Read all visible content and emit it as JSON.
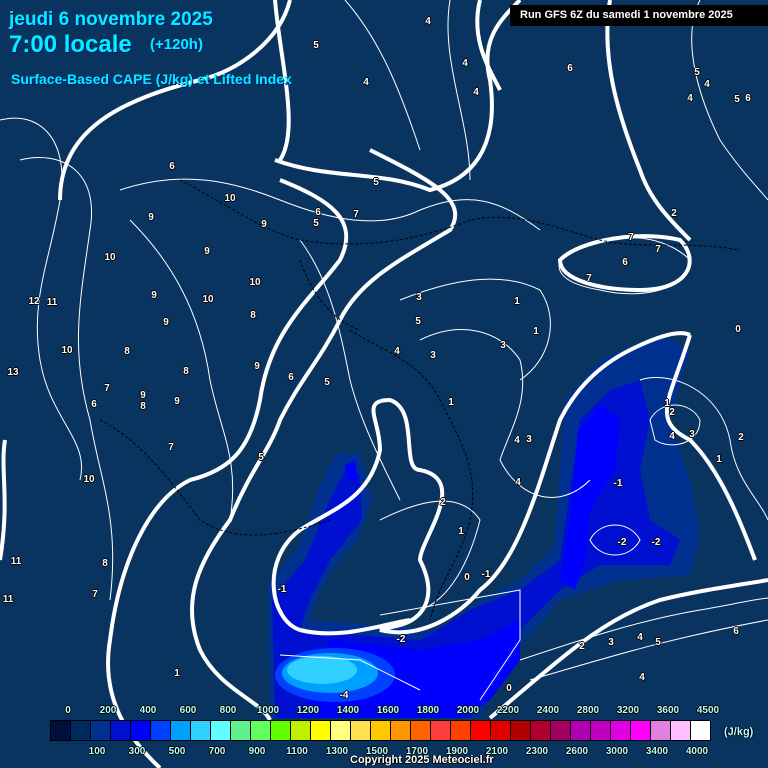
{
  "header": {
    "date": "jeudi 6 novembre 2025",
    "time": "7:00 locale",
    "lead": "(+120h)",
    "parameter": "Surface-Based CAPE (J/kg) et Lifted Index",
    "run": "Run GFS 6Z du samedi 1 novembre 2025"
  },
  "colors": {
    "background": "#0a3460",
    "contour": "#ffffff",
    "title": "#00f0ff"
  },
  "legend": {
    "unit": "(J/kg)",
    "colors": [
      "#00103c",
      "#002a5e",
      "#003090",
      "#0010d0",
      "#0000ff",
      "#0040ff",
      "#00a0ff",
      "#30d0ff",
      "#60ffff",
      "#60f090",
      "#60ff60",
      "#60ff00",
      "#c0f000",
      "#ffff00",
      "#ffff80",
      "#ffe050",
      "#ffc800",
      "#ff9600",
      "#ff6400",
      "#ff3c3c",
      "#ff4000",
      "#ff0000",
      "#e00000",
      "#b00000",
      "#b00030",
      "#a00060",
      "#b000b0",
      "#c000c0",
      "#e000e0",
      "#ff00ff",
      "#e080e0",
      "#ffc0ff",
      "#ffffff"
    ],
    "top_labels": [
      "0",
      "200",
      "400",
      "600",
      "800",
      "1000",
      "1200",
      "1400",
      "1600",
      "1800",
      "2000",
      "2200",
      "2400",
      "2800",
      "3200",
      "3600",
      "4500"
    ],
    "bottom_labels": [
      "100",
      "300",
      "500",
      "700",
      "900",
      "1100",
      "1300",
      "1500",
      "1700",
      "1900",
      "2100",
      "2300",
      "2600",
      "3000",
      "3400",
      "4000"
    ]
  },
  "lifted_index_labels": [
    "4",
    "5",
    "4",
    "4",
    "4",
    "6",
    "5",
    "4",
    "4",
    "5",
    "6",
    "6",
    "5",
    "10",
    "9",
    "9",
    "6",
    "5",
    "7",
    "2",
    "7",
    "7",
    "6",
    "7",
    "9",
    "10",
    "10",
    "9",
    "10",
    "12",
    "11",
    "3",
    "1",
    "8",
    "9",
    "5",
    "1",
    "0",
    "10",
    "8",
    "4",
    "3",
    "3",
    "13",
    "8",
    "9",
    "6",
    "5",
    "7",
    "9",
    "8",
    "9",
    "6",
    "1",
    "1",
    "2",
    "7",
    "5",
    "4",
    "3",
    "4",
    "3",
    "2",
    "1",
    "4",
    "-1",
    "10",
    "2",
    "1",
    "-2",
    "-2",
    "11",
    "8",
    "7",
    "0",
    "-1",
    "-1",
    "11",
    "-2",
    "2",
    "3",
    "4",
    "5",
    "6",
    "4",
    "1",
    "0",
    "-4"
  ],
  "copyright": "Copyright 2025 Meteociel.fr"
}
